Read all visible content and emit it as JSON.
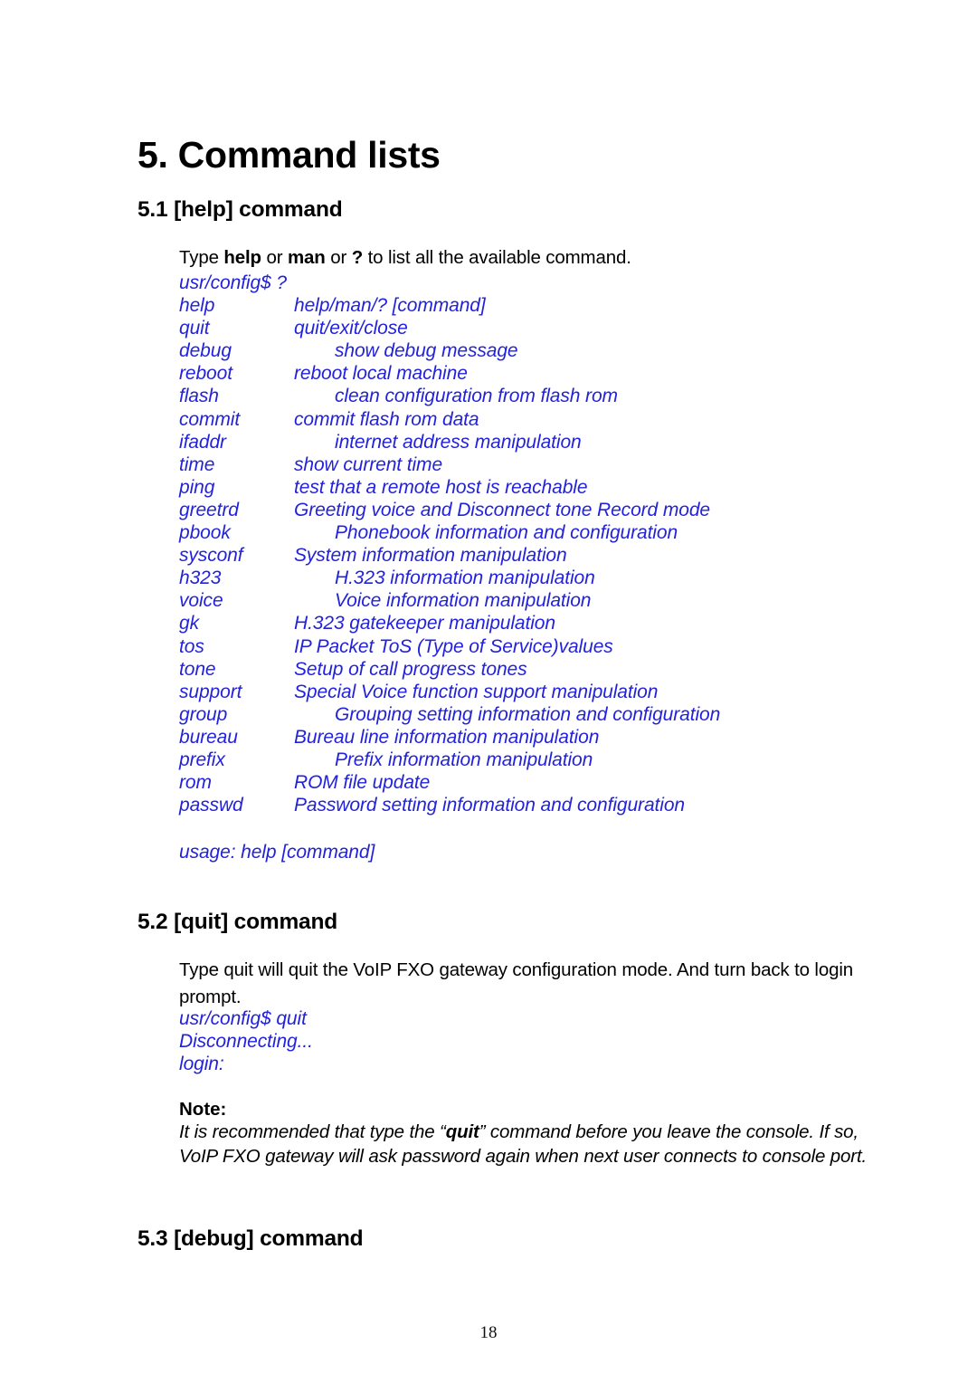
{
  "page": {
    "number": "18",
    "accent_blue": "#2222DD",
    "text_color": "#000000",
    "background": "#ffffff"
  },
  "title": "5. Command lists",
  "sections": {
    "help": {
      "heading": "5.1 [help] command",
      "intro": {
        "prefix": "Type ",
        "bold1": "help",
        "mid1": " or ",
        "bold2": "man",
        "mid2": " or ",
        "bold3": "?",
        "suffix": " to list all the available command."
      },
      "prompt": "usr/config$ ?",
      "commands": [
        {
          "name": "help",
          "desc": "help/man/? [command]",
          "tab": 1
        },
        {
          "name": "quit",
          "desc": "quit/exit/close",
          "tab": 1
        },
        {
          "name": "debug",
          "desc": "show debug message",
          "tab": 2
        },
        {
          "name": "reboot",
          "desc": "reboot local machine",
          "tab": 1
        },
        {
          "name": "flash",
          "desc": "clean configuration from flash rom",
          "tab": 2
        },
        {
          "name": "commit",
          "desc": "commit flash rom data",
          "tab": 1
        },
        {
          "name": "ifaddr",
          "desc": "internet address manipulation",
          "tab": 2
        },
        {
          "name": "time",
          "desc": "show current time",
          "tab": 1
        },
        {
          "name": "ping",
          "desc": "test that a remote host is reachable",
          "tab": 1
        },
        {
          "name": "greetrd",
          "desc": "Greeting voice and Disconnect tone Record mode",
          "tab": 1
        },
        {
          "name": "pbook",
          "desc": "Phonebook information and configuration",
          "tab": 2
        },
        {
          "name": "sysconf",
          "desc": "System information manipulation",
          "tab": 1
        },
        {
          "name": "h323",
          "desc": "H.323 information manipulation",
          "tab": 2
        },
        {
          "name": "voice",
          "desc": "Voice information manipulation",
          "tab": 2
        },
        {
          "name": "gk",
          "desc": "H.323 gatekeeper manipulation",
          "tab": 1
        },
        {
          "name": "tos",
          "desc": "IP Packet ToS (Type of Service)values",
          "tab": 1
        },
        {
          "name": "tone",
          "desc": "Setup of call progress tones",
          "tab": 1
        },
        {
          "name": "support",
          "desc": "Special Voice function support manipulation",
          "tab": 1
        },
        {
          "name": "group",
          "desc": "Grouping setting information and configuration",
          "tab": 2
        },
        {
          "name": "bureau",
          "desc": "Bureau line information manipulation",
          "tab": 1
        },
        {
          "name": "prefix",
          "desc": "Prefix information manipulation",
          "tab": 2
        },
        {
          "name": "rom",
          "desc": "ROM file update",
          "tab": 1
        },
        {
          "name": "passwd",
          "desc": "Password setting information and configuration",
          "tab": 1
        }
      ],
      "usage": "usage: help [command]"
    },
    "quit": {
      "heading": "5.2 [quit] command",
      "body": "Type quit will quit the VoIP FXO gateway configuration mode. And turn back to login prompt.",
      "console": [
        "usr/config$ quit",
        "Disconnecting...",
        "login:"
      ],
      "note": {
        "label": "Note:",
        "prefix": "It is recommended that type the “",
        "bold": "quit",
        "suffix": "” command before you leave the console. If so, VoIP FXO gateway will ask password again when next user connects to console port."
      }
    },
    "debug": {
      "heading": "5.3 [debug] command"
    }
  }
}
